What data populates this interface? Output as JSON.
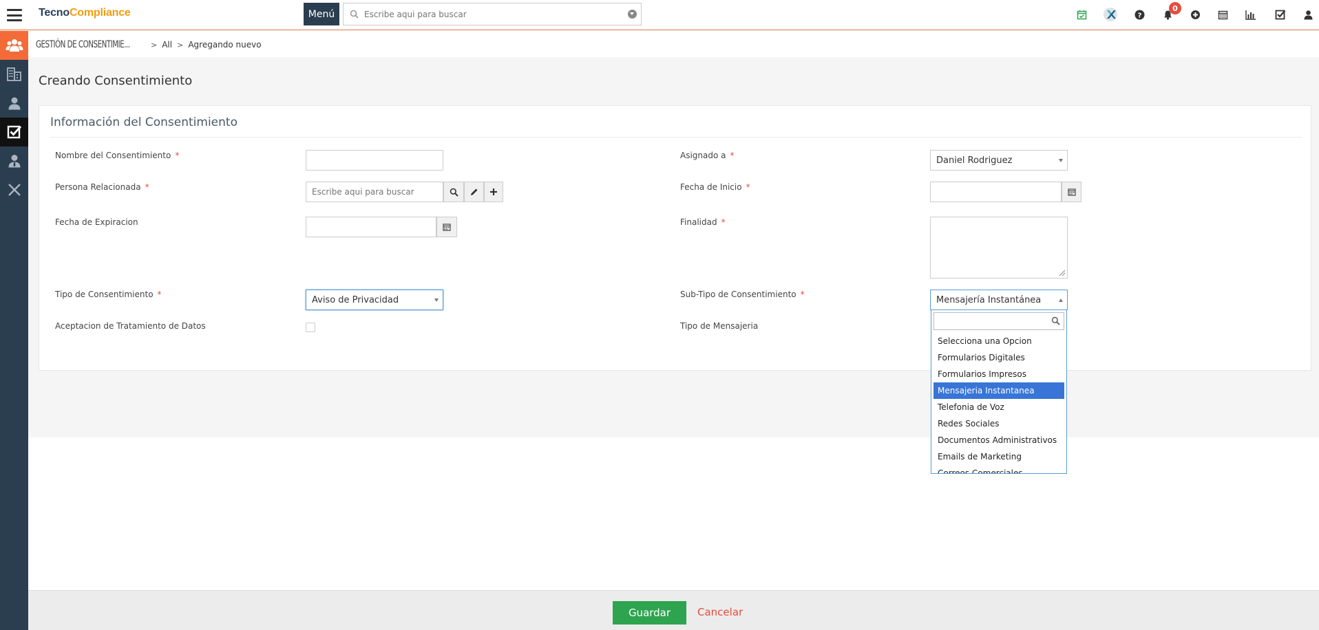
{
  "header": {
    "logo_part1": "Tecno",
    "logo_part2": "Compliance",
    "menu_label": "Menú",
    "search_placeholder": "Escribe aqui para buscar",
    "notification_count": "0",
    "brand_orange": "#f39c12",
    "brand_navy": "#2a3e5c",
    "icons": [
      "calendar-check-icon",
      "x-logo-icon",
      "help-icon",
      "bell-icon",
      "plus-circle-icon",
      "calendar-icon",
      "bar-chart-icon",
      "checkbox-icon",
      "user-icon"
    ]
  },
  "sidebar": {
    "items": [
      "users-group-icon",
      "buildings-icon",
      "person-icon",
      "checkbox-icon",
      "person-tie-icon",
      "close-icon"
    ]
  },
  "breadcrumb": {
    "module": "GESTIÓN DE CONSENTIMIE...",
    "all": "All",
    "current": "Agregando nuevo"
  },
  "page": {
    "title": "Creando Consentimiento",
    "panel_title": "Información del Consentimiento"
  },
  "form": {
    "nombre_label": "Nombre del Consentimiento",
    "persona_label": "Persona Relacionada",
    "persona_placeholder": "Escribe aqui para buscar",
    "expiracion_label": "Fecha de Expiracion",
    "tipo_label": "Tipo de Consentimiento",
    "tipo_value": "Aviso de Privacidad",
    "aceptacion_label": "Aceptacion de Tratamiento de Datos",
    "asignado_label": "Asignado a",
    "asignado_value": "Daniel Rodriguez",
    "inicio_label": "Fecha de Inicio",
    "finalidad_label": "Finalidad",
    "subtipo_label": "Sub-Tipo de Consentimiento",
    "subtipo_value": "Mensajería Instantánea",
    "mensajeria_label": "Tipo de Mensajeria",
    "required_mark": "*"
  },
  "dropdown": {
    "options": [
      "Selecciona una Opcion",
      "Formularios Digitales",
      "Formularios Impresos",
      "Mensajeria Instantanea",
      "Telefonia de Voz",
      "Redes Sociales",
      "Documentos Administrativos",
      "Emails de Marketing",
      "Correos Comerciales"
    ],
    "selected_index": 3
  },
  "footer": {
    "save_label": "Guardar",
    "cancel_label": "Cancelar",
    "save_color": "#2ea44f",
    "cancel_color": "#e74c3c"
  }
}
